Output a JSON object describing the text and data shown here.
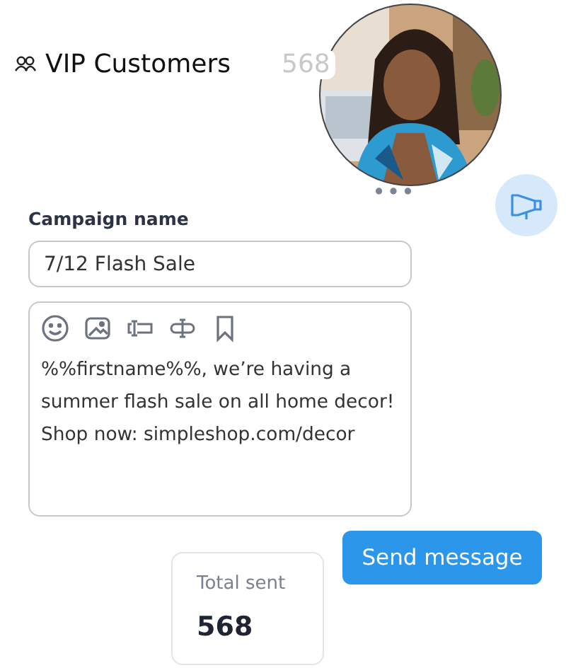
{
  "audience": {
    "name": "VIP Customers",
    "count": "568"
  },
  "campaign_name": {
    "label": "Campaign name",
    "value": "7/12 Flash Sale"
  },
  "message": {
    "text": "%%firstname%%, we’re having a summer flash sale on all home decor! Shop now: simpleshop.com/decor"
  },
  "send_button": "Send message",
  "stats": {
    "label": "Total sent",
    "value": "568"
  }
}
